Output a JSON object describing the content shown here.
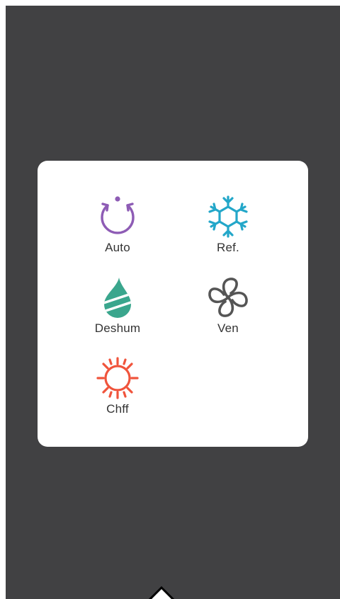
{
  "panel": {
    "modes": [
      {
        "id": "auto",
        "label": "Auto",
        "icon": "auto-cycle-icon",
        "color": "#8e5cb5"
      },
      {
        "id": "cool",
        "label": "Ref.",
        "icon": "snowflake-icon",
        "color": "#23a7c9"
      },
      {
        "id": "dry",
        "label": "Deshum",
        "icon": "water-drop-icon",
        "color": "#3aa68d"
      },
      {
        "id": "fan",
        "label": "Ven",
        "icon": "fan-icon",
        "color": "#555555"
      },
      {
        "id": "heat",
        "label": "Chff",
        "icon": "sun-icon",
        "color": "#f0543c"
      }
    ]
  },
  "colors": {
    "screen_background": "#414143",
    "panel_background": "#ffffff",
    "label_text": "#333333"
  },
  "bottom_handle": {
    "icon": "chevron-up-icon"
  }
}
